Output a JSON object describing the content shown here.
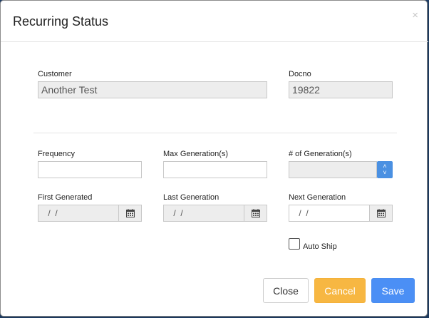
{
  "dialog": {
    "title": "Recurring Status",
    "close_glyph": "×"
  },
  "customer": {
    "label": "Customer",
    "value": "Another Test"
  },
  "docno": {
    "label": "Docno",
    "value": "19822"
  },
  "frequency": {
    "label": "Frequency",
    "value": ""
  },
  "max_generations": {
    "label": "Max Generation(s)",
    "value": ""
  },
  "num_generations": {
    "label": "# of Generation(s)",
    "value": ""
  },
  "first_generated": {
    "label": "First Generated",
    "value": " /  /"
  },
  "last_generation": {
    "label": "Last Generation",
    "value": " /  /"
  },
  "next_generation": {
    "label": "Next Generation",
    "value": " /  /"
  },
  "auto_ship": {
    "label": "Auto Ship",
    "checked": false
  },
  "buttons": {
    "close": "Close",
    "cancel": "Cancel",
    "save": "Save"
  },
  "icons": {
    "calendar": "calendar-icon",
    "spinner": "spinner-icon",
    "close": "close-icon"
  },
  "colors": {
    "save": "#4b8ff5",
    "cancel": "#f7b742",
    "spinner": "#4a90e2"
  }
}
